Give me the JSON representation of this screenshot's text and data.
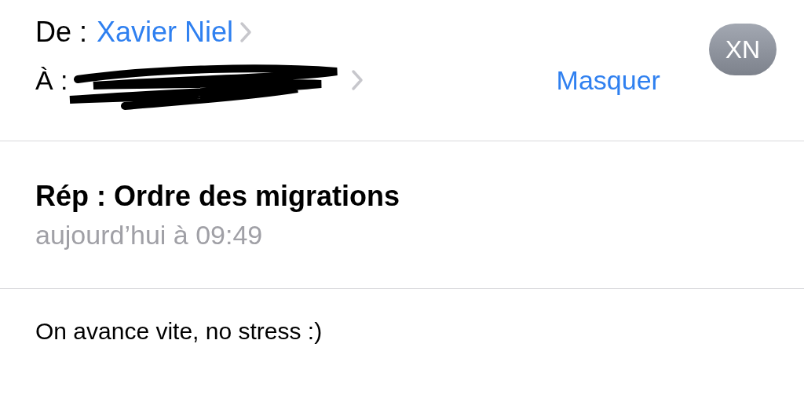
{
  "header": {
    "from_label": "De :",
    "from_name": "Xavier Niel",
    "to_label": "À :",
    "hide_link": "Masquer",
    "avatar_initials": "XN"
  },
  "message": {
    "subject": "Rép : Ordre des migrations",
    "date": "aujourd’hui à 09:49",
    "body": "On avance vite, no stress :)"
  }
}
